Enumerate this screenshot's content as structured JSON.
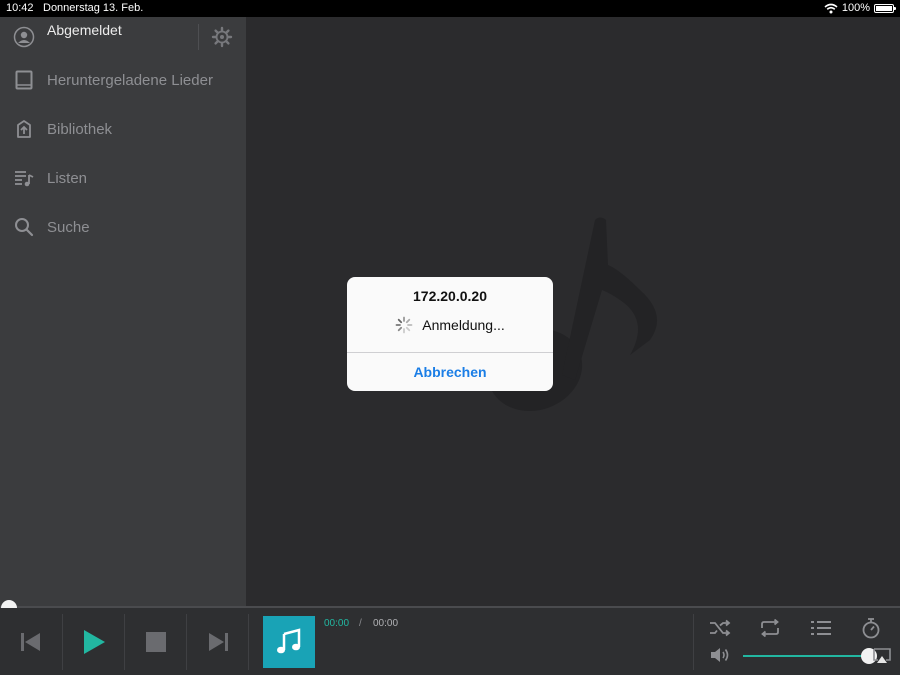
{
  "status_bar": {
    "time": "10:42",
    "date": "Donnerstag 13. Feb.",
    "battery": "100%",
    "battery_level": 1.0
  },
  "sidebar": {
    "account_label": "Abgemeldet",
    "items": [
      {
        "label": "Heruntergeladene Lieder",
        "icon": "tablet-icon"
      },
      {
        "label": "Bibliothek",
        "icon": "library-icon"
      },
      {
        "label": "Listen",
        "icon": "playlist-icon"
      },
      {
        "label": "Suche",
        "icon": "search-icon"
      }
    ]
  },
  "dialog": {
    "title": "172.20.0.20",
    "message": "Anmeldung...",
    "cancel_label": "Abbrechen"
  },
  "player": {
    "elapsed": "00:00",
    "separator": "/",
    "total": "00:00",
    "progress": 0,
    "volume": 1.0,
    "accent_color": "#22b7a1",
    "cover_color": "#19a3b6"
  },
  "colors": {
    "dialog_button": "#1b7ee6",
    "sidebar_bg": "#3b3c3e",
    "main_bg": "#2b2b2d"
  }
}
